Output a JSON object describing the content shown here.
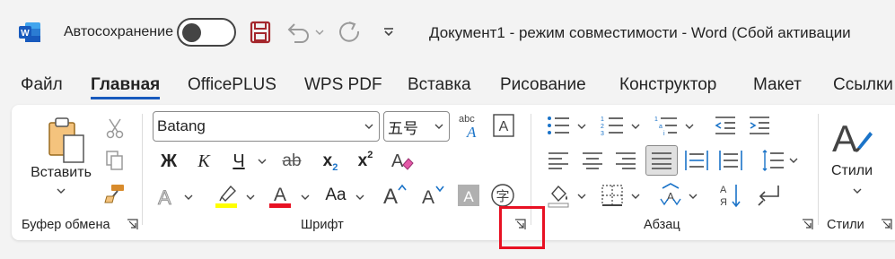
{
  "titlebar": {
    "app_icon_letter": "W",
    "autosave_label": "Автосохранение",
    "document_title": "Документ1  -  режим совместимости  -  Word (Сбой активации"
  },
  "tabs": [
    "Файл",
    "Главная",
    "OfficePLUS",
    "WPS PDF",
    "Вставка",
    "Рисование",
    "Конструктор",
    "Макет",
    "Ссылки"
  ],
  "active_tab": "Главная",
  "ribbon": {
    "clipboard": {
      "paste_label": "Вставить",
      "group_label": "Буфер обмена"
    },
    "font": {
      "font_name": "Batang",
      "font_size": "五号",
      "bold": "Ж",
      "italic": "К",
      "underline": "Ч",
      "strikethrough": "ab",
      "subscript": "x",
      "subscript_sub": "2",
      "superscript": "x",
      "superscript_sup": "2",
      "change_case": "Aa",
      "grow_font": "A",
      "shrink_font": "A",
      "char_shading": "A",
      "enclose_char": "字",
      "phonetic": "abc",
      "clear_format": "A",
      "text_effects": "A",
      "font_color": "A",
      "char_border": "A",
      "group_label": "Шрифт"
    },
    "paragraph": {
      "group_label": "Абзац",
      "sort_label": "Я"
    },
    "styles": {
      "styles_label": "Стили",
      "group_label": "Стили"
    }
  },
  "colors": {
    "accent": "#185abd",
    "highlight": "#ffff00",
    "font_color": "#e81123",
    "annotation_box": "#e81123"
  }
}
